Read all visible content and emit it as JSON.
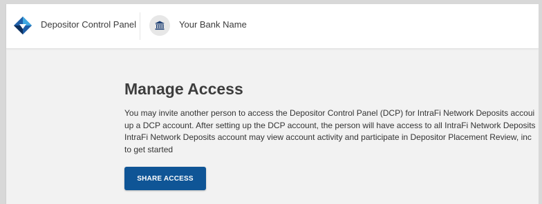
{
  "header": {
    "app_title": "Depositor Control Panel",
    "bank_name": "Your Bank Name",
    "logo_icon": "diamond-logo-icon",
    "bank_icon": "bank-building-icon",
    "colors": {
      "logo_blue": "#1f5fa8",
      "logo_dark": "#0d2f5c",
      "logo_light": "#3fa7e0"
    }
  },
  "main": {
    "title": "Manage Access",
    "description_lines": [
      "You may invite another person to access the Depositor Control Panel (DCP) for IntraFi Network Deposits accoui",
      "up a DCP account. After setting up the DCP account, the person will have access to all IntraFi Network Deposits",
      "IntraFi Network Deposits account may view account activity and participate in Depositor Placement Review, inc",
      "to get started"
    ],
    "share_button_label": "SHARE ACCESS",
    "colors": {
      "button": "#0f5596",
      "background": "#f2f2f2"
    }
  }
}
